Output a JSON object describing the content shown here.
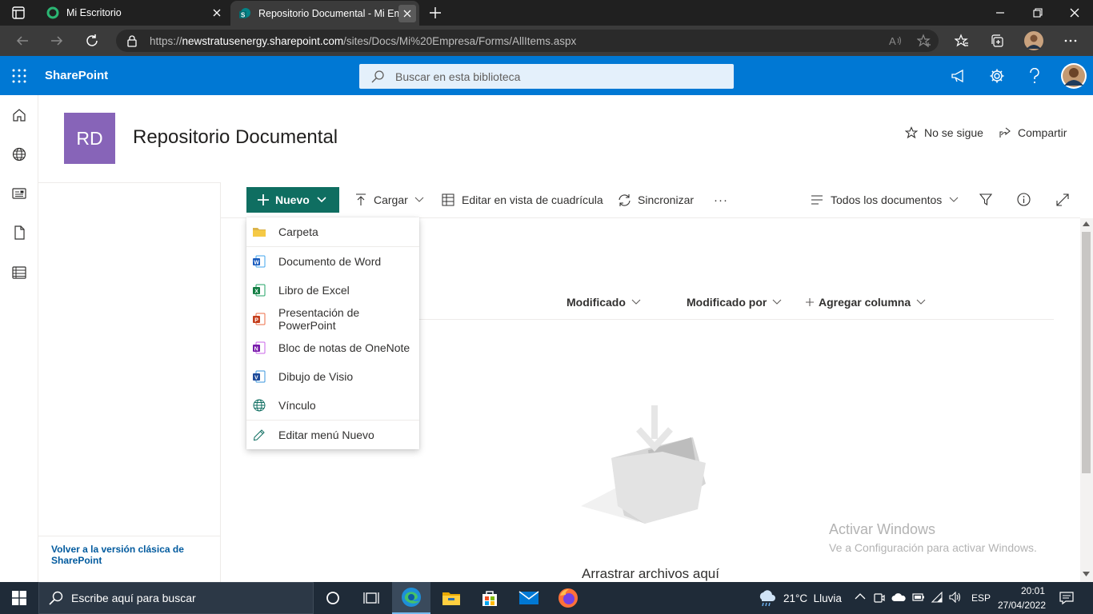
{
  "browser": {
    "tabs": [
      {
        "title": "Mi Escritorio",
        "active": false
      },
      {
        "title": "Repositorio Documental - Mi Em",
        "active": true
      }
    ],
    "url_prefix": "https://",
    "url_host": "newstratusenergy.sharepoint.com",
    "url_path": "/sites/Docs/Mi%20Empresa/Forms/AllItems.aspx"
  },
  "suite": {
    "app_name": "SharePoint",
    "search_placeholder": "Buscar en esta biblioteca",
    "color": "#0078d4"
  },
  "site": {
    "logo_initials": "RD",
    "logo_color": "#8764b8",
    "title": "Repositorio Documental",
    "follow_label": "No se sigue",
    "share_label": "Compartir"
  },
  "leftnav": {
    "classic_link": "Volver a la versión clásica de SharePoint"
  },
  "commandbar": {
    "new_label": "Nuevo",
    "new_color": "#0f6e61",
    "upload_label": "Cargar",
    "grid_label": "Editar en vista de cuadrícula",
    "sync_label": "Sincronizar",
    "more_label": "···",
    "view_label": "Todos los documentos"
  },
  "columns": {
    "modified": "Modificado",
    "modified_by": "Modificado por",
    "add_column": "Agregar columna"
  },
  "new_menu": {
    "items": [
      {
        "label": "Carpeta",
        "icon": "folder-icon"
      },
      {
        "label": "Documento de Word",
        "icon": "word-icon"
      },
      {
        "label": "Libro de Excel",
        "icon": "excel-icon"
      },
      {
        "label": "Presentación de PowerPoint",
        "icon": "powerpoint-icon"
      },
      {
        "label": "Bloc de notas de OneNote",
        "icon": "onenote-icon"
      },
      {
        "label": "Dibujo de Visio",
        "icon": "visio-icon"
      },
      {
        "label": "Vínculo",
        "icon": "globe-icon"
      },
      {
        "label": "Editar menú Nuevo",
        "icon": "pencil-icon"
      }
    ]
  },
  "empty_state": {
    "message": "Arrastrar archivos aquí"
  },
  "watermark": {
    "line1": "Activar Windows",
    "line2": "Ve a Configuración para activar Windows."
  },
  "taskbar": {
    "search_placeholder": "Escribe aquí para buscar",
    "weather": "21°C  Lluvia",
    "language": "ESP",
    "time": "20:01",
    "date": "27/04/2022"
  }
}
